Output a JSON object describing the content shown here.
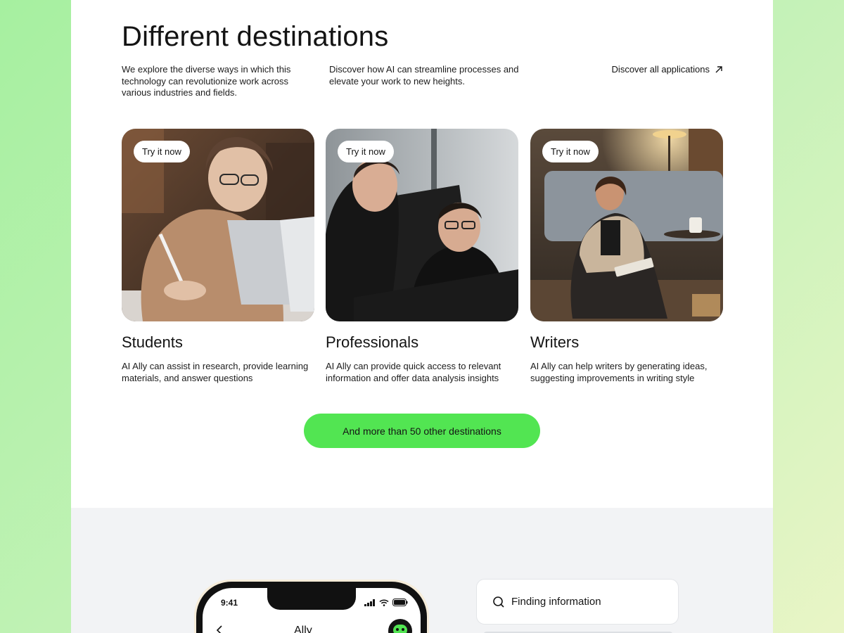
{
  "section": {
    "title": "Different destinations",
    "intro_left": "We explore the diverse ways in which this technology can revolutionize work across various industries and fields.",
    "intro_right": "Discover how AI can streamline processes and elevate your work to new heights.",
    "discover_link": "Discover all applications",
    "discover_icon": "arrow-up-right-icon"
  },
  "cards": [
    {
      "button": "Try it now",
      "title": "Students",
      "description": "AI Ally can assist in research, provide learning materials, and answer questions"
    },
    {
      "button": "Try it now",
      "title": "Professionals",
      "description": "AI Ally can provide quick access to relevant information and  offer data analysis insights"
    },
    {
      "button": "Try it now",
      "title": "Writers",
      "description": "AI Ally can help writers by generating ideas, suggesting improvements in writing style"
    }
  ],
  "cta": {
    "label": "And more than 50 other destinations",
    "color": "#52e552"
  },
  "phone": {
    "time": "9:41",
    "app_name": "Ally",
    "back_icon": "chevron-left-icon",
    "status_icons": [
      "signal-icon",
      "wifi-icon",
      "battery-icon"
    ]
  },
  "feature": {
    "label": "Finding information",
    "icon": "search-icon"
  },
  "colors": {
    "accent": "#52e552",
    "lower_bg": "#f2f3f5",
    "text": "#141414"
  }
}
